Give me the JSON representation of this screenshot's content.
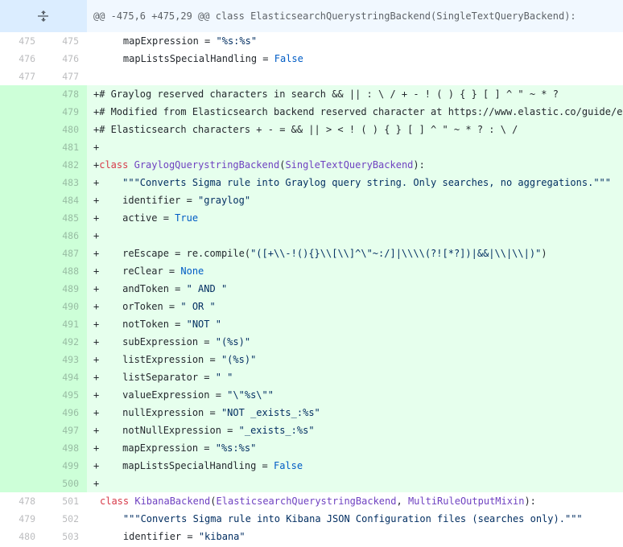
{
  "hunk": {
    "header": "@@ -475,6 +475,29 @@ class ElasticsearchQuerystringBackend(SingleTextQueryBackend):",
    "expand_icon": "unfold-icon"
  },
  "lines": [
    {
      "old": "475",
      "new": "475",
      "type": "ctx",
      "segs": [
        {
          "t": "    mapExpression = "
        },
        {
          "t": "\"%s:%s\"",
          "c": "str"
        }
      ]
    },
    {
      "old": "476",
      "new": "476",
      "type": "ctx",
      "segs": [
        {
          "t": "    mapListsSpecialHandling = "
        },
        {
          "t": "False",
          "c": "cst"
        }
      ]
    },
    {
      "old": "477",
      "new": "477",
      "type": "ctx",
      "segs": [
        {
          "t": ""
        }
      ]
    },
    {
      "old": "",
      "new": "478",
      "type": "add",
      "segs": [
        {
          "t": "+# Graylog reserved characters in search && || : \\ / + - ! ( ) { } [ ] ^ \" ~ * ?"
        }
      ]
    },
    {
      "old": "",
      "new": "479",
      "type": "add",
      "segs": [
        {
          "t": "+# Modified from Elasticsearch backend reserved character at https://www.elastic.co/guide/en/elastic"
        }
      ]
    },
    {
      "old": "",
      "new": "480",
      "type": "add",
      "segs": [
        {
          "t": "+# Elasticsearch characters + - = && || > < ! ( ) { } [ ] ^ \" ~ * ? : \\ /"
        }
      ]
    },
    {
      "old": "",
      "new": "481",
      "type": "add",
      "segs": [
        {
          "t": "+"
        }
      ]
    },
    {
      "old": "",
      "new": "482",
      "type": "add",
      "segs": [
        {
          "t": "+"
        },
        {
          "t": "class ",
          "c": "kw"
        },
        {
          "t": "GraylogQuerystringBackend",
          "c": "ent"
        },
        {
          "t": "("
        },
        {
          "t": "SingleTextQueryBackend",
          "c": "ent"
        },
        {
          "t": "):"
        }
      ]
    },
    {
      "old": "",
      "new": "483",
      "type": "add",
      "segs": [
        {
          "t": "+    "
        },
        {
          "t": "\"\"\"Converts Sigma rule into Graylog query string. Only searches, no aggregations.\"\"\"",
          "c": "str"
        }
      ]
    },
    {
      "old": "",
      "new": "484",
      "type": "add",
      "segs": [
        {
          "t": "+    identifier = "
        },
        {
          "t": "\"graylog\"",
          "c": "str"
        }
      ]
    },
    {
      "old": "",
      "new": "485",
      "type": "add",
      "segs": [
        {
          "t": "+    active = "
        },
        {
          "t": "True",
          "c": "cst"
        }
      ]
    },
    {
      "old": "",
      "new": "486",
      "type": "add",
      "segs": [
        {
          "t": "+"
        }
      ]
    },
    {
      "old": "",
      "new": "487",
      "type": "add",
      "segs": [
        {
          "t": "+    reEscape = re.compile("
        },
        {
          "t": "\"([+\\\\-!(){}\\\\[\\\\]^\\\"~:/]|\\\\\\\\(?![*?])|&&|\\\\|\\\\|)\"",
          "c": "str"
        },
        {
          "t": ")"
        }
      ]
    },
    {
      "old": "",
      "new": "488",
      "type": "add",
      "segs": [
        {
          "t": "+    reClear = "
        },
        {
          "t": "None",
          "c": "cst"
        }
      ]
    },
    {
      "old": "",
      "new": "489",
      "type": "add",
      "segs": [
        {
          "t": "+    andToken = "
        },
        {
          "t": "\" AND \"",
          "c": "str"
        }
      ]
    },
    {
      "old": "",
      "new": "490",
      "type": "add",
      "segs": [
        {
          "t": "+    orToken = "
        },
        {
          "t": "\" OR \"",
          "c": "str"
        }
      ]
    },
    {
      "old": "",
      "new": "491",
      "type": "add",
      "segs": [
        {
          "t": "+    notToken = "
        },
        {
          "t": "\"NOT \"",
          "c": "str"
        }
      ]
    },
    {
      "old": "",
      "new": "492",
      "type": "add",
      "segs": [
        {
          "t": "+    subExpression = "
        },
        {
          "t": "\"(%s)\"",
          "c": "str"
        }
      ]
    },
    {
      "old": "",
      "new": "493",
      "type": "add",
      "segs": [
        {
          "t": "+    listExpression = "
        },
        {
          "t": "\"(%s)\"",
          "c": "str"
        }
      ]
    },
    {
      "old": "",
      "new": "494",
      "type": "add",
      "segs": [
        {
          "t": "+    listSeparator = "
        },
        {
          "t": "\" \"",
          "c": "str"
        }
      ]
    },
    {
      "old": "",
      "new": "495",
      "type": "add",
      "segs": [
        {
          "t": "+    valueExpression = "
        },
        {
          "t": "\"\\\"%s\\\"\"",
          "c": "str"
        }
      ]
    },
    {
      "old": "",
      "new": "496",
      "type": "add",
      "segs": [
        {
          "t": "+    nullExpression = "
        },
        {
          "t": "\"NOT _exists_:%s\"",
          "c": "str"
        }
      ]
    },
    {
      "old": "",
      "new": "497",
      "type": "add",
      "segs": [
        {
          "t": "+    notNullExpression = "
        },
        {
          "t": "\"_exists_:%s\"",
          "c": "str"
        }
      ]
    },
    {
      "old": "",
      "new": "498",
      "type": "add",
      "segs": [
        {
          "t": "+    mapExpression = "
        },
        {
          "t": "\"%s:%s\"",
          "c": "str"
        }
      ]
    },
    {
      "old": "",
      "new": "499",
      "type": "add",
      "segs": [
        {
          "t": "+    mapListsSpecialHandling = "
        },
        {
          "t": "False",
          "c": "cst"
        }
      ]
    },
    {
      "old": "",
      "new": "500",
      "type": "add",
      "segs": [
        {
          "t": "+"
        }
      ]
    },
    {
      "old": "478",
      "new": "501",
      "type": "ctx",
      "segs": [
        {
          "t": "class ",
          "c": "kw"
        },
        {
          "t": "KibanaBackend",
          "c": "ent"
        },
        {
          "t": "("
        },
        {
          "t": "ElasticsearchQuerystringBackend",
          "c": "ent"
        },
        {
          "t": ", "
        },
        {
          "t": "MultiRuleOutputMixin",
          "c": "ent"
        },
        {
          "t": "):"
        }
      ]
    },
    {
      "old": "479",
      "new": "502",
      "type": "ctx",
      "segs": [
        {
          "t": "    "
        },
        {
          "t": "\"\"\"Converts Sigma rule into Kibana JSON Configuration files (searches only).\"\"\"",
          "c": "str"
        }
      ]
    },
    {
      "old": "480",
      "new": "503",
      "type": "ctx",
      "segs": [
        {
          "t": "    identifier = "
        },
        {
          "t": "\"kibana\"",
          "c": "str"
        }
      ]
    }
  ]
}
